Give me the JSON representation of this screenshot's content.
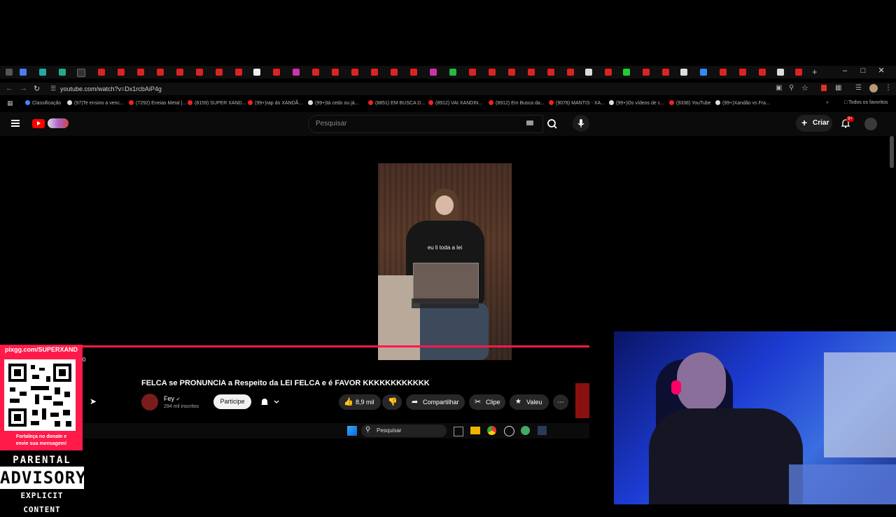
{
  "browser": {
    "url": "youtube.com/watch?v=Dx1rcbAiP4g",
    "bookmarks": [
      "Classificação",
      "(97)Te ensino a venc...",
      "(7292) Eneias Metal |...",
      "(8159) SUPER XAND...",
      "(99+)rap do XANDÃ...",
      "(99+)tá cedo ou já...",
      "(8851) EM BUSCA D...",
      "(8912) VAI XANDIN...",
      "(8912) Em Busca da...",
      "(9078) MANTIS - XA...",
      "(99+)Os vídeos de c...",
      "(9338) YouTube",
      "(99+)Xandão vs Fra..."
    ],
    "all_bookmarks": "Todos os favoritos"
  },
  "youtube": {
    "search_placeholder": "Pesquisar",
    "create_label": "Criar",
    "notification_badge": "9+"
  },
  "video": {
    "caption": "eu li toda a lei",
    "title": "FELCA se PRONUNCIA a Respeito da LEI FELCA e é FAVOR KKKKKKKKKKKK",
    "channel_name": "Fey",
    "subscribers": "294 mil inscritos",
    "join_label": "Participe",
    "likes": "8,9 mil",
    "share_label": "Compartilhar",
    "clip_label": "Clipe",
    "thanks_label": "Valeu",
    "counter": "0"
  },
  "taskbar": {
    "search_placeholder": "Pesquisar"
  },
  "overlay": {
    "donate_url": "pixgg.com/SUPERXAND",
    "donate_message_line1": "Fortaleça no donate e",
    "donate_message_line2": "envie sua mensagem!",
    "pa_top": "PARENTAL",
    "pa_middle": "ADVISORY",
    "pa_bottom": "EXPLICIT CONTENT"
  },
  "colors": {
    "youtube_red": "#ff0000",
    "progress": "#ff1a4a",
    "background": "#000000"
  }
}
